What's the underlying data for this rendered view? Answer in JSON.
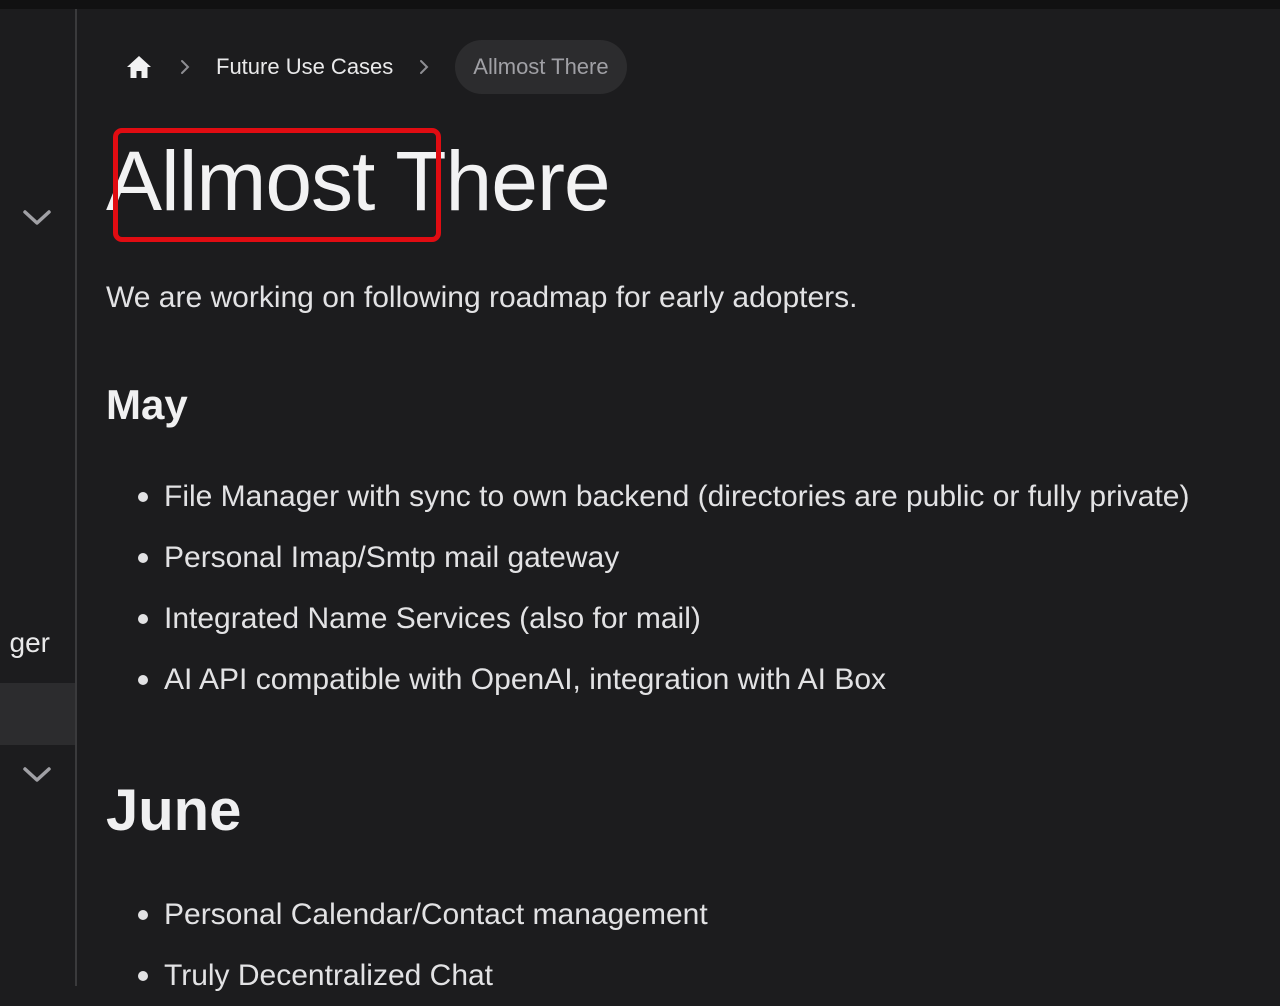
{
  "sidebar": {
    "partial_label": "ger"
  },
  "breadcrumb": {
    "home_icon": "home-icon",
    "items": [
      "Future Use Cases"
    ],
    "current": "Allmost There"
  },
  "page": {
    "title_word1": "Allmost",
    "title_word2": "There",
    "intro": "We are working on following roadmap for early adopters.",
    "highlight_color": "#e00c12"
  },
  "sections": [
    {
      "heading": "May",
      "items": [
        "File Manager with sync to own backend (directories are public or fully private)",
        "Personal Imap/Smtp mail gateway",
        "Integrated Name Services (also for mail)",
        "AI API compatible with OpenAI, integration with AI Box"
      ]
    },
    {
      "heading": "June",
      "items": [
        "Personal Calendar/Contact management",
        "Truly Decentralized Chat"
      ]
    }
  ]
}
